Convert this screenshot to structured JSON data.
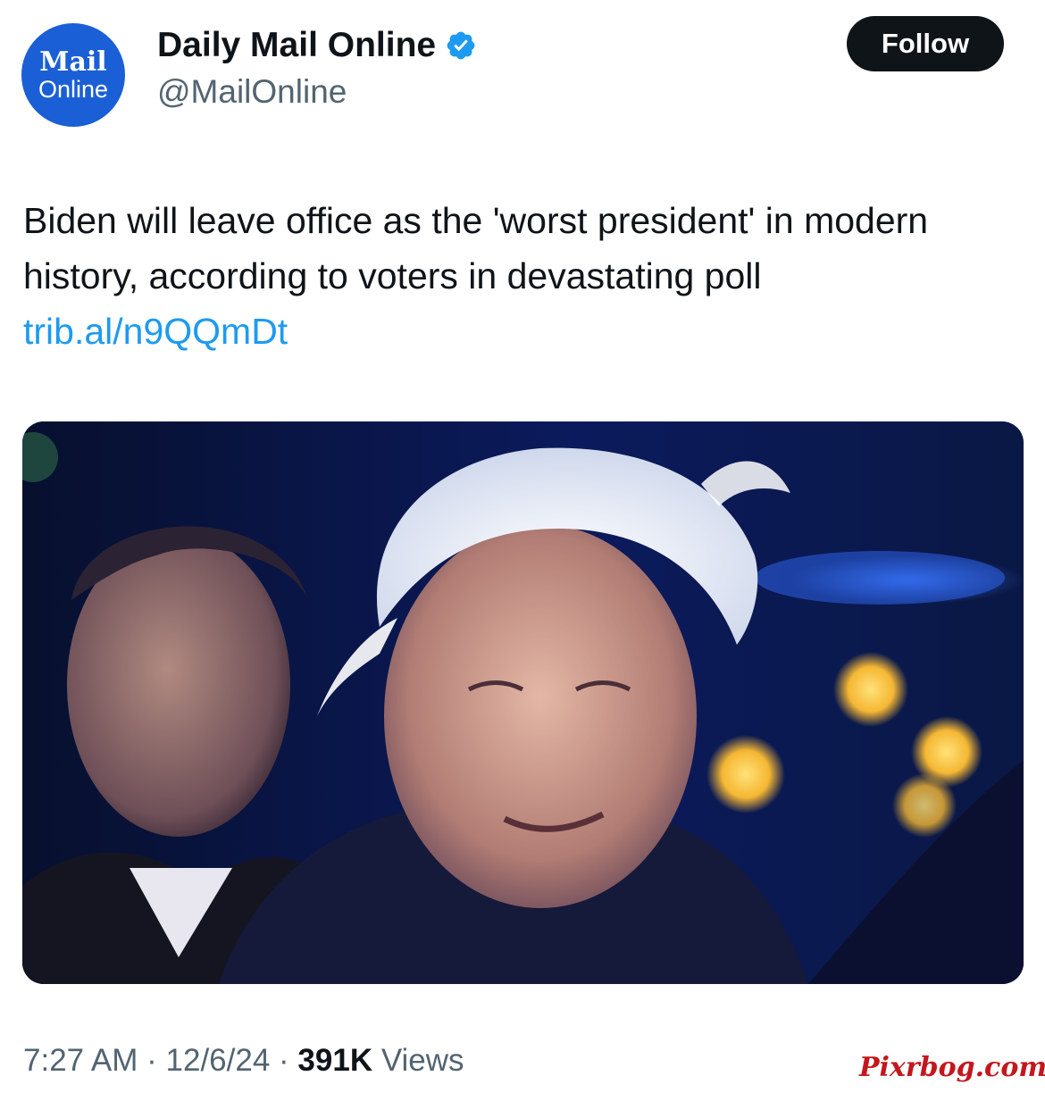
{
  "header": {
    "avatar": {
      "line1": "Mail",
      "line2": "Online",
      "background": "#1a5fd6"
    },
    "display_name": "Daily Mail Online",
    "verified_icon": "verified-badge-icon",
    "handle": "@MailOnline",
    "follow_label": "Follow"
  },
  "tweet": {
    "text": "Biden will leave office as the 'worst president' in modern history, according to voters in devastating poll",
    "link": "trib.al/n9QQmDt",
    "link_color": "#1d9bf0"
  },
  "media": {
    "type": "photo"
  },
  "meta": {
    "time": "7:27 AM",
    "sep1": " · ",
    "date": "12/6/24",
    "sep2": " · ",
    "views_count": "391K",
    "views_label": " Views"
  },
  "watermark": {
    "text": "Pixrbog.com",
    "color": "#c4171d"
  }
}
